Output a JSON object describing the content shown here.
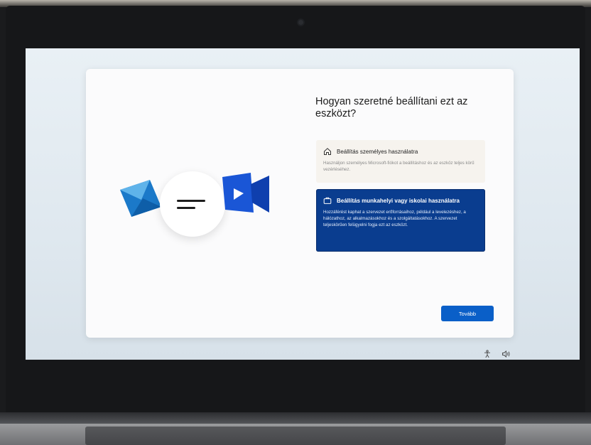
{
  "setup": {
    "title": "Hogyan szeretné beállítani ezt az eszközt?",
    "options": [
      {
        "title": "Beállítás személyes használatra",
        "description": "Használjon személyes Microsoft-fiókot a beállításhoz és az eszköz teljes körű vezérléséhez.",
        "icon": "home-icon",
        "selected": false
      },
      {
        "title": "Beállítás munkahelyi vagy iskolai használatra",
        "description": "Hozzáférést kaphat a szervezet erőforrásaihoz, például a levelezéshez, a hálózathoz, az alkalmazásokhoz és a szolgáltatásokhoz. A szervezet teljeskörűen felügyelni fogja ezt az eszközt.",
        "icon": "briefcase-icon",
        "selected": true
      }
    ],
    "next_label": "Tovább"
  },
  "system_tray": {
    "icons": [
      "accessibility-icon",
      "volume-icon"
    ]
  },
  "colors": {
    "accent": "#0a5fc8",
    "selected_option": "#0a3d8f",
    "card": "#fbfbfc"
  }
}
